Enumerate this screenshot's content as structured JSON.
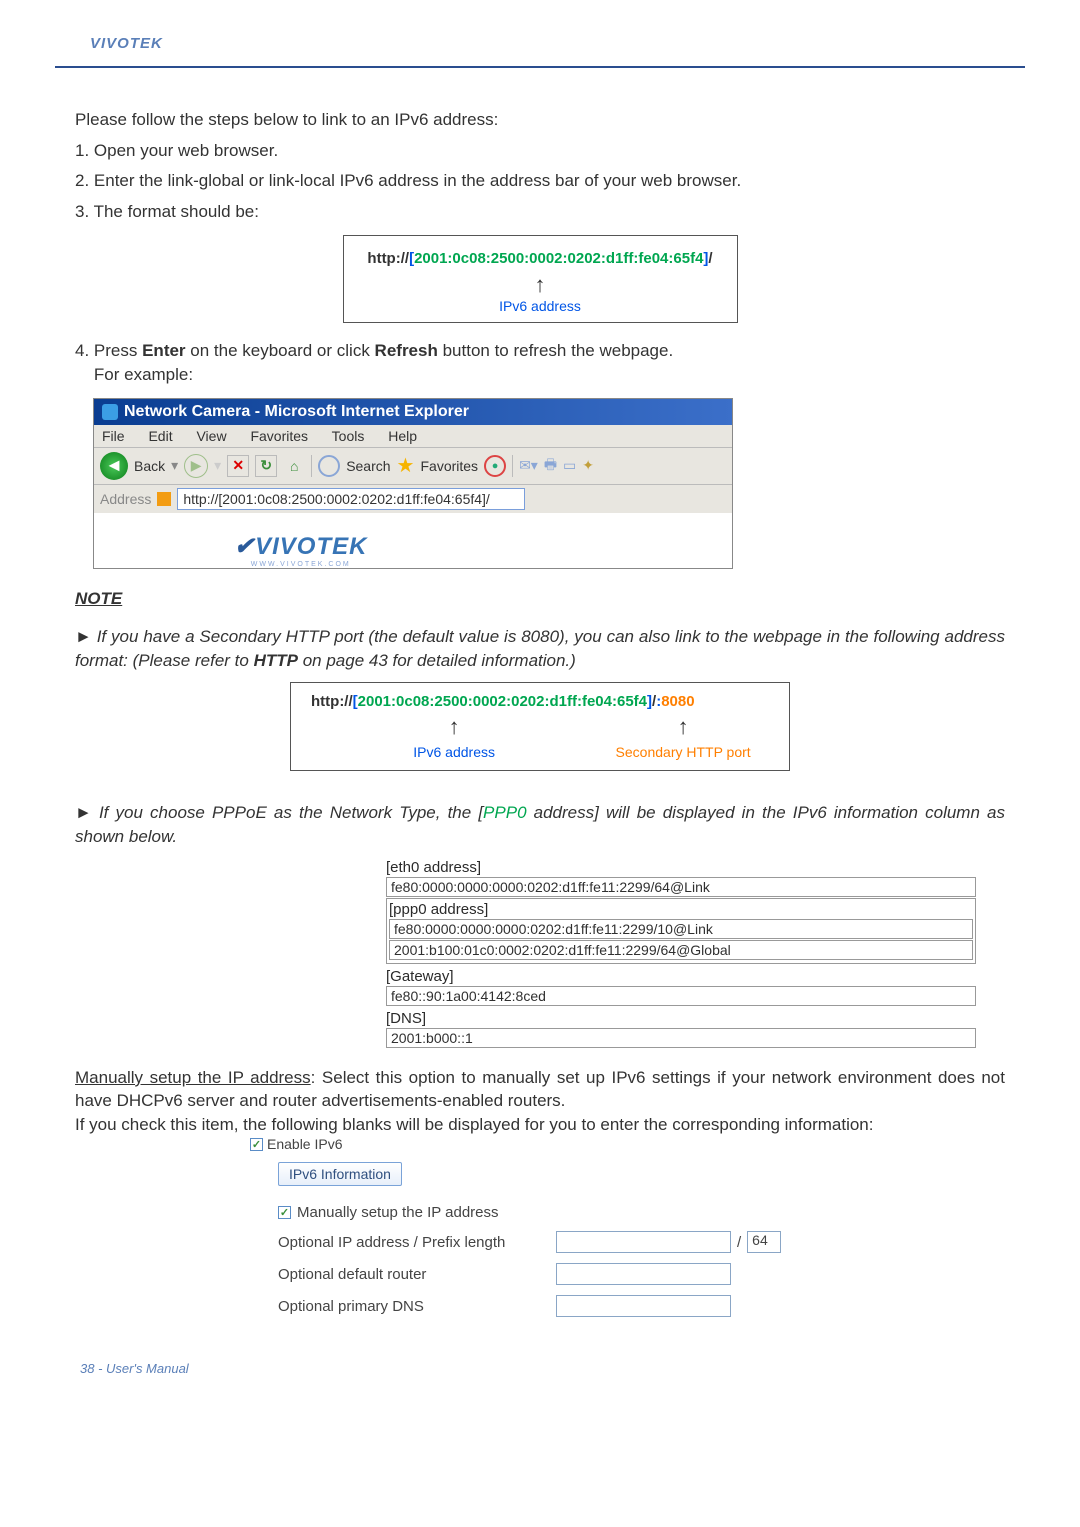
{
  "brand": "VIVOTEK",
  "intro": {
    "lead": "Please follow the steps below to link to an IPv6 address:",
    "step1": "1. Open your web browser.",
    "step2": "2. Enter the link-global or link-local IPv6 address in the address bar of your web browser.",
    "step3": "3. The format should be:"
  },
  "url_box1": {
    "prefix": "http://",
    "open": "[",
    "ipv6": "2001:0c08:2500:0002:0202:d1ff:fe04:65f4",
    "close": "]",
    "suffix": "/",
    "arrow": "↑",
    "label": "IPv6 address"
  },
  "step4": {
    "line1_a": "4. Press ",
    "enter": "Enter",
    "line1_b": " on the keyboard or click ",
    "refresh": "Refresh",
    "line1_c": " button to refresh the webpage.",
    "line2": "    For example:"
  },
  "ie": {
    "title": "Network Camera - Microsoft Internet Explorer",
    "menu": {
      "file": "File",
      "edit": "Edit",
      "view": "View",
      "favorites": "Favorites",
      "tools": "Tools",
      "help": "Help"
    },
    "toolbar": {
      "back": "Back",
      "search": "Search",
      "favorites": "Favorites"
    },
    "address_label": "Address",
    "address_value": "http://[2001:0c08:2500:0002:0202:d1ff:fe04:65f4]/",
    "logo": "VIVOTEK",
    "logo_sub": "WWW.VIVOTEK.COM"
  },
  "note": {
    "heading": "NOTE",
    "para1_a": "► If you have a Secondary HTTP port (the default value is 8080), you can also link to the webpage in the following address format: (Please refer to ",
    "para1_http": "HTTP",
    "para1_b": " on page 43 for detailed information.)"
  },
  "url_box2": {
    "prefix": "http://",
    "open": "[",
    "ipv6": "2001:0c08:2500:0002:0202:d1ff:fe04:65f4",
    "close": "]",
    "suffix": "/",
    "colon": ":",
    "port": "8080",
    "arrow": "↑",
    "label_ipv6": "IPv6 address",
    "label_port": "Secondary HTTP port"
  },
  "note2": {
    "para_a": "► If you choose PPPoE as the Network Type, the [",
    "pppoe": "PPP0",
    "para_b": " address] will be displayed in the IPv6 information column as shown below."
  },
  "ipv6info": {
    "eth0_hdr": "[eth0 address]",
    "eth0_val": "fe80:0000:0000:0000:0202:d1ff:fe11:2299/64@Link",
    "ppp0_hdr": "[ppp0 address]",
    "ppp0_val1": "fe80:0000:0000:0000:0202:d1ff:fe11:2299/10@Link",
    "ppp0_val2": "2001:b100:01c0:0002:0202:d1ff:fe11:2299/64@Global",
    "gw_hdr": "[Gateway]",
    "gw_val": "fe80::90:1a00:4142:8ced",
    "dns_hdr": "[DNS]",
    "dns_val": "2001:b000::1"
  },
  "manual": {
    "uline": "Manually setup the IP address",
    "rest": ": Select this option to manually set up IPv6 settings if your network environment does not have DHCPv6 server and router advertisements-enabled routers.",
    "line2": "If you check this item, the following blanks will be displayed for you to enter the corresponding information:"
  },
  "settings": {
    "enable": "Enable IPv6",
    "info_btn": "IPv6 Information",
    "manual_chk": "Manually setup the IP address",
    "opt_ip": "Optional IP address / Prefix length",
    "prefix_val": "64",
    "opt_router": "Optional default router",
    "opt_dns": "Optional primary DNS"
  },
  "footer": "38 - User's Manual"
}
